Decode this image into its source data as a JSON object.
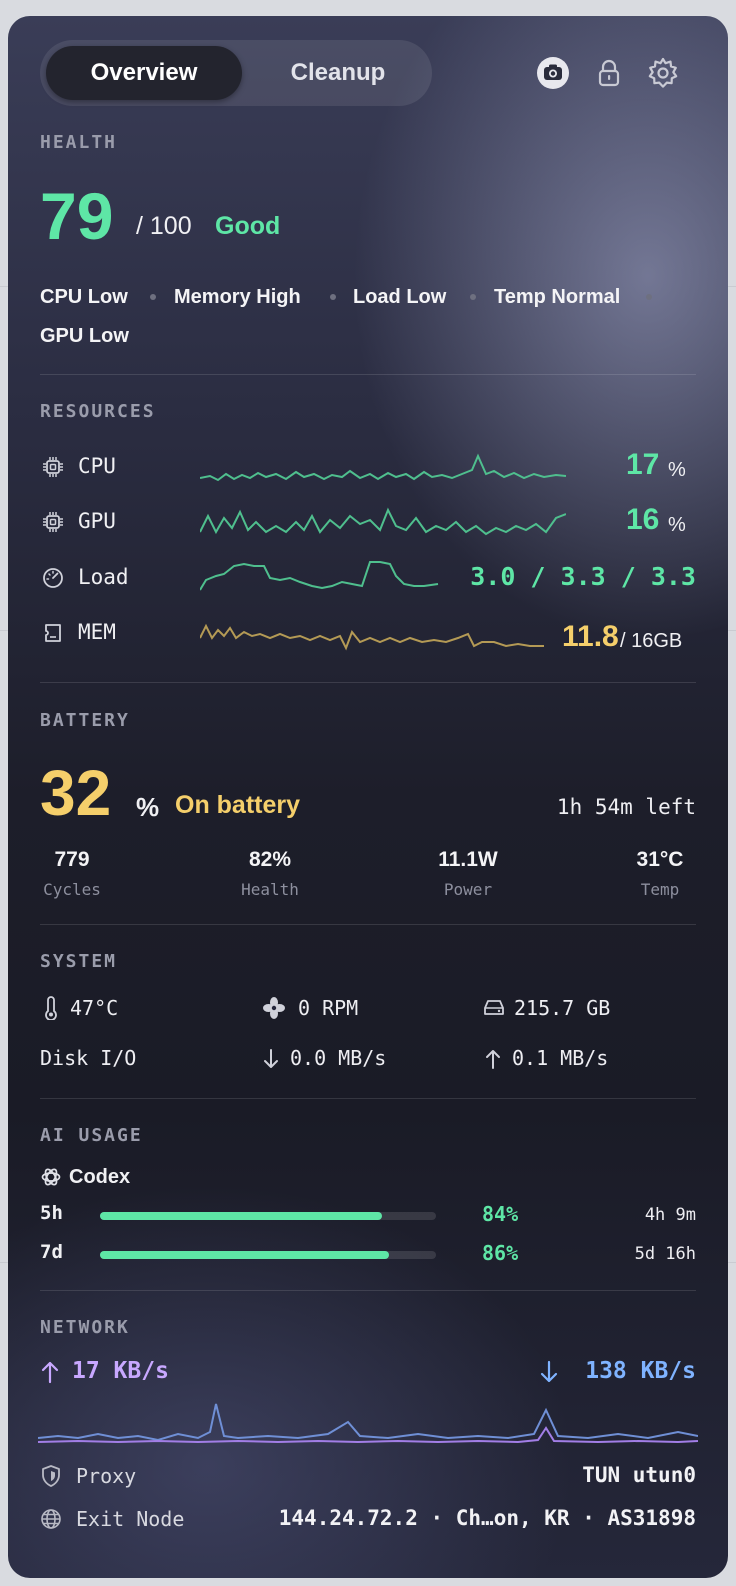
{
  "colors": {
    "green": "#5ee6a6",
    "yellow": "#f5cf6b",
    "purple": "#c8a8ff",
    "blue": "#7fb3ff",
    "muted": "#9a9cab"
  },
  "tabs": {
    "overview": "Overview",
    "cleanup": "Cleanup"
  },
  "toolbar_icons": [
    "camera-icon",
    "lock-icon",
    "gear-icon"
  ],
  "health": {
    "title": "HEALTH",
    "score": "79",
    "max": "/ 100",
    "status": "Good",
    "chips": [
      "CPU Low",
      "Memory High",
      "Load Low",
      "Temp Normal",
      "GPU Low"
    ]
  },
  "resources": {
    "title": "RESOURCES",
    "cpu": {
      "label": "CPU",
      "value": "17",
      "unit": "%"
    },
    "gpu": {
      "label": "GPU",
      "value": "16",
      "unit": "%"
    },
    "load": {
      "label": "Load",
      "value": "3.0 / 3.3 / 3.3"
    },
    "mem": {
      "label": "MEM",
      "value": "11.8",
      "unit": "/ 16GB"
    }
  },
  "battery": {
    "title": "BATTERY",
    "percent": "32",
    "unit": "%",
    "state": "On battery",
    "remaining": "1h 54m left",
    "stats": [
      {
        "value": "779",
        "label": "Cycles"
      },
      {
        "value": "82%",
        "label": "Health"
      },
      {
        "value": "11.1W",
        "label": "Power"
      },
      {
        "value": "31°C",
        "label": "Temp"
      }
    ]
  },
  "system": {
    "title": "SYSTEM",
    "temp": "47°C",
    "fan": "0 RPM",
    "disk": "215.7 GB",
    "disk_io_label": "Disk I/O",
    "disk_read": "0.0 MB/s",
    "disk_write": "0.1 MB/s"
  },
  "ai_usage": {
    "title": "AI USAGE",
    "provider": "Codex",
    "rows": [
      {
        "label": "5h",
        "percent": "84%",
        "fill": 0.84,
        "reset": "4h 9m"
      },
      {
        "label": "7d",
        "percent": "86%",
        "fill": 0.86,
        "reset": "5d 16h"
      }
    ]
  },
  "network": {
    "title": "NETWORK",
    "upload": "17 KB/s",
    "download": "138 KB/s",
    "proxy_label": "Proxy",
    "proxy_value": "TUN utun0",
    "exit_label": "Exit Node",
    "exit_value": "144.24.72.2 · Ch…on, KR · AS31898"
  }
}
